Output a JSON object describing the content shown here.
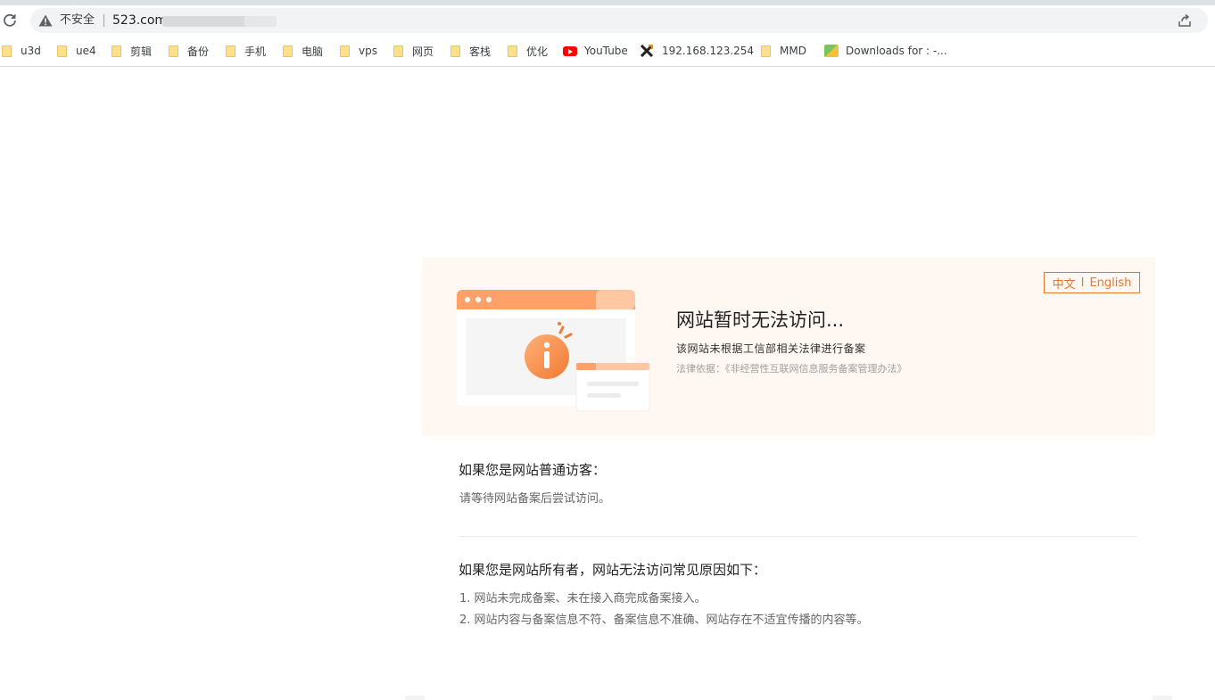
{
  "browser": {
    "not_secure_label": "不安全",
    "url": "523.com"
  },
  "bookmarks": [
    {
      "label": "u3d",
      "icon": "folder-icon"
    },
    {
      "label": "ue4",
      "icon": "folder-icon"
    },
    {
      "label": "剪辑",
      "icon": "folder-icon"
    },
    {
      "label": "备份",
      "icon": "folder-icon"
    },
    {
      "label": "手机",
      "icon": "folder-icon"
    },
    {
      "label": "电脑",
      "icon": "folder-icon"
    },
    {
      "label": "vps",
      "icon": "folder-icon"
    },
    {
      "label": "网页",
      "icon": "folder-icon"
    },
    {
      "label": "客栈",
      "icon": "folder-icon"
    },
    {
      "label": "优化",
      "icon": "folder-icon"
    },
    {
      "label": "YouTube",
      "icon": "youtube-icon"
    },
    {
      "label": "192.168.123.254",
      "icon": "x-logo-icon"
    },
    {
      "label": "MMD",
      "icon": "folder-icon"
    },
    {
      "label": "Downloads for : -...",
      "icon": "downloads-site-icon"
    }
  ],
  "notice": {
    "lang_zh": "中文",
    "lang_sep": "I",
    "lang_en": "English",
    "title": "网站暂时无法访问...",
    "subtitle": "该网站未根据工信部相关法律进行备案",
    "law": "法律依据：《非经营性互联网信息服务备案管理办法》"
  },
  "visitor": {
    "heading": "如果您是网站普通访客：",
    "text": "请等待网站备案后尝试访问。"
  },
  "owner": {
    "heading": "如果您是网站所有者，网站无法访问常见原因如下：",
    "reasons": [
      "1. 网站未完成备案、未在接入商完成备案接入。",
      "2. 网站内容与备案信息不符、备案信息不准确、网站存在不适宜传播的内容等。"
    ]
  },
  "colors": {
    "accent": "#e8772a",
    "hero_bg": "#fff7f2"
  }
}
